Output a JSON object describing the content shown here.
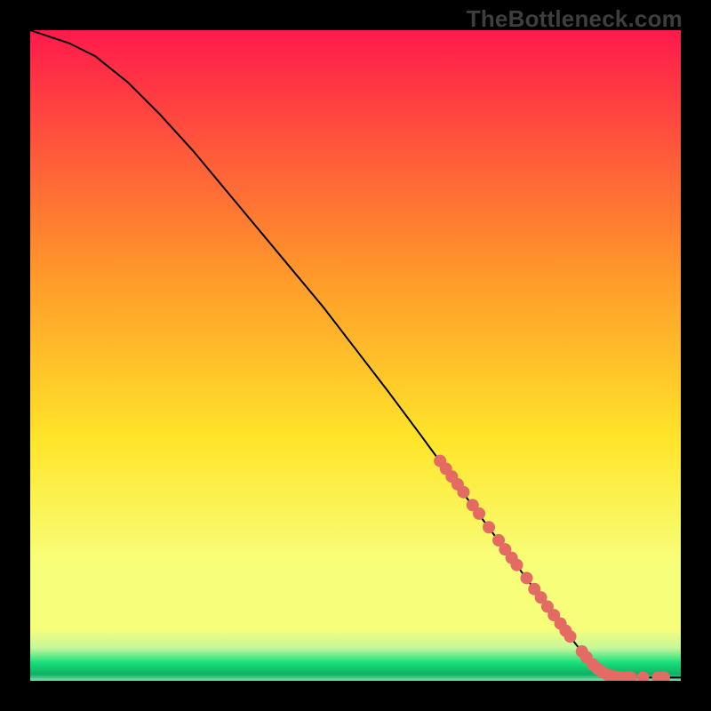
{
  "watermark": "TheBottleneck.com",
  "colors": {
    "gradient_top": "#ff1a4b",
    "gradient_mid1": "#ff9a2a",
    "gradient_mid2": "#ffe52a",
    "gradient_mid3": "#f7ff7a",
    "gradient_bottom_yellow": "#f7ff7a",
    "green": "#18e07a",
    "curve": "#000000",
    "marker_fill": "#e46a64",
    "marker_edge": "#c94d49"
  },
  "chart_data": {
    "type": "line",
    "title": "",
    "xlabel": "",
    "ylabel": "",
    "xlim": [
      0,
      100
    ],
    "ylim": [
      0,
      100
    ],
    "series": [
      {
        "name": "curve",
        "x": [
          0,
          3,
          6,
          10,
          15,
          20,
          25,
          30,
          35,
          40,
          45,
          50,
          55,
          60,
          63,
          66,
          70,
          74,
          78,
          82,
          85,
          89,
          92,
          95,
          98,
          100
        ],
        "y": [
          100,
          99,
          98,
          96,
          92,
          87,
          81.5,
          75.5,
          69.5,
          63.5,
          57.5,
          51,
          44.5,
          37.8,
          33.7,
          29.6,
          24.2,
          18.8,
          13.4,
          8.0,
          4.2,
          1.3,
          0.6,
          0.5,
          0.5,
          0.5
        ]
      }
    ],
    "markers": [
      {
        "x": 63.0,
        "y": 33.8
      },
      {
        "x": 63.9,
        "y": 32.6
      },
      {
        "x": 64.8,
        "y": 31.4
      },
      {
        "x": 65.7,
        "y": 30.2
      },
      {
        "x": 66.6,
        "y": 29.0
      },
      {
        "x": 68.0,
        "y": 27.0
      },
      {
        "x": 69.0,
        "y": 25.7
      },
      {
        "x": 70.5,
        "y": 23.6
      },
      {
        "x": 72.0,
        "y": 21.6
      },
      {
        "x": 73.0,
        "y": 20.2
      },
      {
        "x": 74.0,
        "y": 18.9
      },
      {
        "x": 74.8,
        "y": 17.8
      },
      {
        "x": 76.3,
        "y": 15.8
      },
      {
        "x": 77.5,
        "y": 14.1
      },
      {
        "x": 78.5,
        "y": 12.8
      },
      {
        "x": 79.5,
        "y": 11.4
      },
      {
        "x": 80.5,
        "y": 10.1
      },
      {
        "x": 81.5,
        "y": 8.8
      },
      {
        "x": 82.3,
        "y": 7.7
      },
      {
        "x": 83.0,
        "y": 6.8
      },
      {
        "x": 84.8,
        "y": 4.5
      },
      {
        "x": 85.5,
        "y": 3.6
      },
      {
        "x": 86.5,
        "y": 2.5
      },
      {
        "x": 87.3,
        "y": 1.8
      },
      {
        "x": 88.0,
        "y": 1.3
      },
      {
        "x": 88.8,
        "y": 0.9
      },
      {
        "x": 89.3,
        "y": 0.7
      },
      {
        "x": 90.0,
        "y": 0.6
      },
      {
        "x": 90.8,
        "y": 0.55
      },
      {
        "x": 91.7,
        "y": 0.5
      },
      {
        "x": 92.3,
        "y": 0.5
      },
      {
        "x": 94.2,
        "y": 0.5
      },
      {
        "x": 96.5,
        "y": 0.5
      },
      {
        "x": 97.4,
        "y": 0.5
      }
    ]
  }
}
